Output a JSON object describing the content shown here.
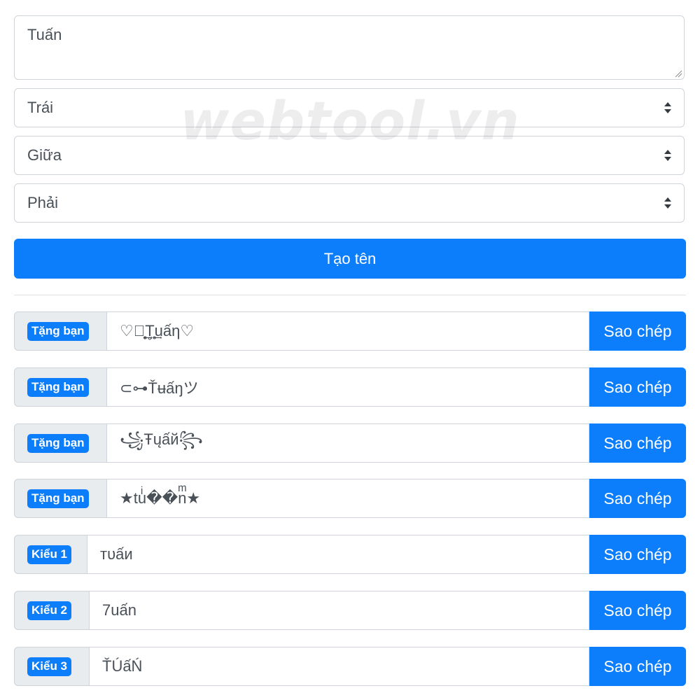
{
  "watermark": "webtool.vn",
  "form": {
    "name_value": "Tuấn",
    "left_select": "Trái",
    "middle_select": "Giữa",
    "right_select": "Phải",
    "submit_label": "Tạo tên"
  },
  "results": [
    {
      "badge": "Tặng bạn",
      "value": "♡ঌ̥̥̥̥̥̥̥̥̥̥̥̥̥̥̥̥̥͢T̥̥̥͢uấη♡",
      "copy": "Sao chép"
    },
    {
      "badge": "Tặng bạn",
      "value": "⊂⊶Ťʉấŋツ",
      "copy": "Sao chép"
    },
    {
      "badge": "Tặng bạn",
      "value": "꧁Ŧųấй꧂",
      "copy": "Sao chép"
    },
    {
      "badge": "Tặng bạn",
      "value": "★tuͥ��nͫ★",
      "copy": "Sao chép"
    },
    {
      "badge": "Kiểu 1",
      "value": "тυấи",
      "copy": "Sao chép"
    },
    {
      "badge": "Kiểu 2",
      "value": "7uấn",
      "copy": "Sao chép"
    },
    {
      "badge": "Kiểu 3",
      "value": "ŤÚấŃ",
      "copy": "Sao chép"
    }
  ]
}
